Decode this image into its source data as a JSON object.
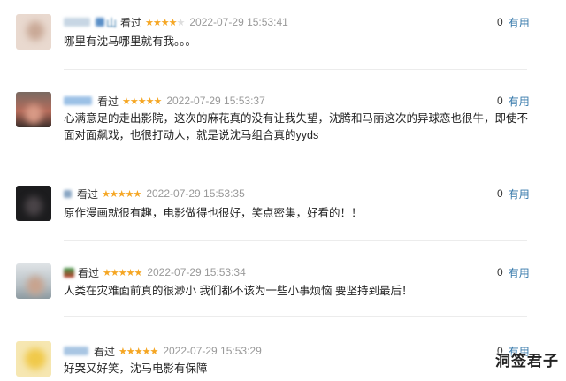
{
  "reviews": [
    {
      "username": "山",
      "seen_label": "看过",
      "rating_stars": 4,
      "timestamp": "2022-07-29 15:53:41",
      "votes": "0",
      "useful_label": "有用",
      "content": "哪里有沈马哪里就有我。。。"
    },
    {
      "username": "",
      "seen_label": "看过",
      "rating_stars": 5,
      "timestamp": "2022-07-29 15:53:37",
      "votes": "0",
      "useful_label": "有用",
      "content": "心满意足的走出影院，这次的麻花真的没有让我失望，沈腾和马丽这次的异球恋也很牛，即使不面对面飙戏，也很打动人，就是说沈马组合真的yyds"
    },
    {
      "username": "",
      "seen_label": "看过",
      "rating_stars": 5,
      "timestamp": "2022-07-29 15:53:35",
      "votes": "0",
      "useful_label": "有用",
      "content": "原作漫画就很有趣，电影做得也很好，笑点密集，好看的！！"
    },
    {
      "username": "",
      "seen_label": "看过",
      "rating_stars": 5,
      "timestamp": "2022-07-29 15:53:34",
      "votes": "0",
      "useful_label": "有用",
      "content": "人类在灾难面前真的很渺小 我们都不该为一些小事烦恼 要坚持到最后！"
    },
    {
      "username": "",
      "seen_label": "看过",
      "rating_stars": 5,
      "timestamp": "2022-07-29 15:53:29",
      "votes": "0",
      "useful_label": "有用",
      "content": "好哭又好笑，沈马电影有保障"
    }
  ],
  "watermark": "洞签君子",
  "colors": {
    "star": "#f5a623",
    "link": "#3377aa",
    "muted": "#999999"
  }
}
